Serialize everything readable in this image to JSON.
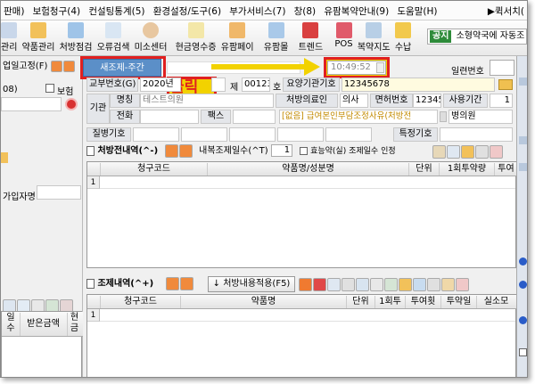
{
  "menu": {
    "items": [
      "판매)",
      "보험청구(4)",
      "컨설팅통계(5)",
      "환경설정/도구(6)",
      "부가서비스(7)",
      "창(8)",
      "유팜복약안내(9)",
      "도움말(H)"
    ],
    "right": "▶퀵서치("
  },
  "toolbar": {
    "buttons": [
      "관리",
      "약품관리",
      "처방점검",
      "오류검색",
      "미소센터",
      "현금영수증",
      "유팜페이",
      "유팜몰",
      "트렌드",
      "POS",
      "복약지도",
      "수납"
    ],
    "notice_tag": "공지",
    "notice_text": "소형약국에 자동조"
  },
  "left_panel": {
    "fix_label": "업일고정(F)",
    "code_fragment": "08)",
    "insurance_label": "보험",
    "subscriber_label": "가입자명",
    "columns": [
      "일수",
      "받은금액",
      "현금"
    ]
  },
  "header": {
    "new_rx_button": "새조제-주간",
    "time": "10:49:52",
    "serial_label": "일련번호",
    "issue_no_label": "교부번호(G)",
    "issue_year": "2020년",
    "je_label": "제",
    "issue_no": "00123",
    "ho_label": "호",
    "institution_no_label": "요양기관기호",
    "institution_no": "12345678"
  },
  "institution": {
    "group_label": "기관",
    "name_label": "명칭",
    "name": "테스트의원",
    "phone_label": "전화",
    "fax_label": "팩스",
    "doctor_label": "처방의료인",
    "doctor_type": "의사",
    "license_label": "면허번호",
    "license_no": "12345",
    "period_label": "사용기간",
    "period": "1",
    "copay_reason": "[없음] 급여본인부담조정사유(처방전",
    "clinic_type": "병의원"
  },
  "disease": {
    "label": "질병기호",
    "special_label": "특정기호"
  },
  "rx": {
    "title": "처방전내역(^-)",
    "days_label": "내복조제일수(^T)",
    "days": "1",
    "effect_label": "효능약(실) 조제일수 인정",
    "columns": [
      "청구코드",
      "약품명/성분명",
      "단위",
      "1회투약량",
      "투여"
    ],
    "rows": [
      "1"
    ]
  },
  "disp": {
    "title": "조제내역(^+)",
    "apply_button": "처방내용적용(F5)",
    "columns": [
      "청구코드",
      "약품명",
      "단위",
      "1회투",
      "투여횟",
      "투약일",
      "실소모"
    ],
    "rows": [
      "1"
    ]
  },
  "callout": {
    "text": "클릭"
  },
  "colors": {
    "highlight_red": "#e02020",
    "highlight_yellow": "#f2d200",
    "new_rx_bg": "#5b8fc8",
    "notice_green": "#2e8b3a",
    "label_bg": "#e4e6ea"
  }
}
